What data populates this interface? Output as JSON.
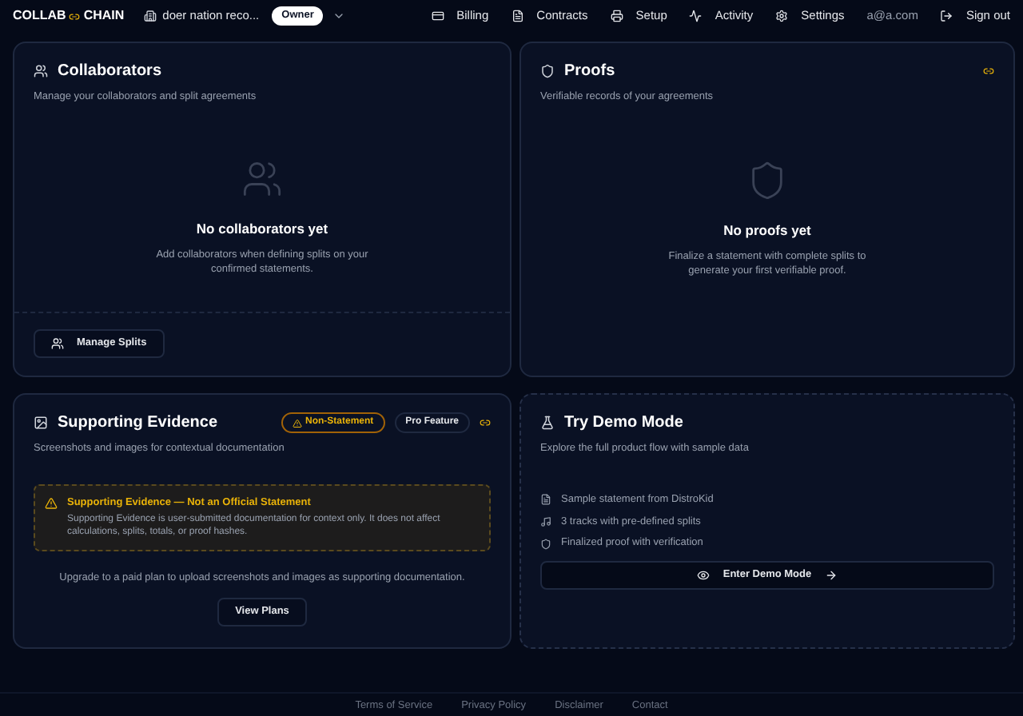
{
  "header": {
    "logo_left": "COLLAB",
    "logo_right": "CHAIN",
    "workspace": "doer nation reco...",
    "role_badge": "Owner",
    "nav": [
      {
        "label": "Billing"
      },
      {
        "label": "Contracts"
      },
      {
        "label": "Setup"
      },
      {
        "label": "Activity"
      },
      {
        "label": "Settings"
      }
    ],
    "email": "a@a.com",
    "sign_out": "Sign out"
  },
  "collaborators": {
    "title": "Collaborators",
    "subtitle": "Manage your collaborators and split agreements",
    "empty_title": "No collaborators yet",
    "empty_text": "Add collaborators when defining splits on your confirmed statements.",
    "button": "Manage Splits"
  },
  "proofs": {
    "title": "Proofs",
    "subtitle": "Verifiable records of your agreements",
    "empty_title": "No proofs yet",
    "empty_text": "Finalize a statement with complete splits to generate your first verifiable proof."
  },
  "evidence": {
    "title": "Supporting Evidence",
    "badges": [
      {
        "label": "Non-Statement",
        "kind": "warning"
      },
      {
        "label": "Pro Feature",
        "kind": "plain"
      }
    ],
    "subtitle": "Screenshots and images for contextual documentation",
    "alert_title": "Supporting Evidence — Not an Official Statement",
    "alert_text": "Supporting Evidence is user-submitted documentation for context only. It does not affect calculations, splits, totals, or proof hashes.",
    "upgrade_text": "Upgrade to a paid plan to upload screenshots and images as supporting documentation.",
    "button": "View Plans"
  },
  "demo": {
    "title": "Try Demo Mode",
    "subtitle": "Explore the full product flow with sample data",
    "features": [
      {
        "label": "Sample statement from DistroKid"
      },
      {
        "label": "3 tracks with pre-defined splits"
      },
      {
        "label": "Finalized proof with verification"
      }
    ],
    "button": "Enter Demo Mode"
  },
  "footer": [
    "Terms of Service",
    "Privacy Policy",
    "Disclaimer",
    "Contact"
  ]
}
